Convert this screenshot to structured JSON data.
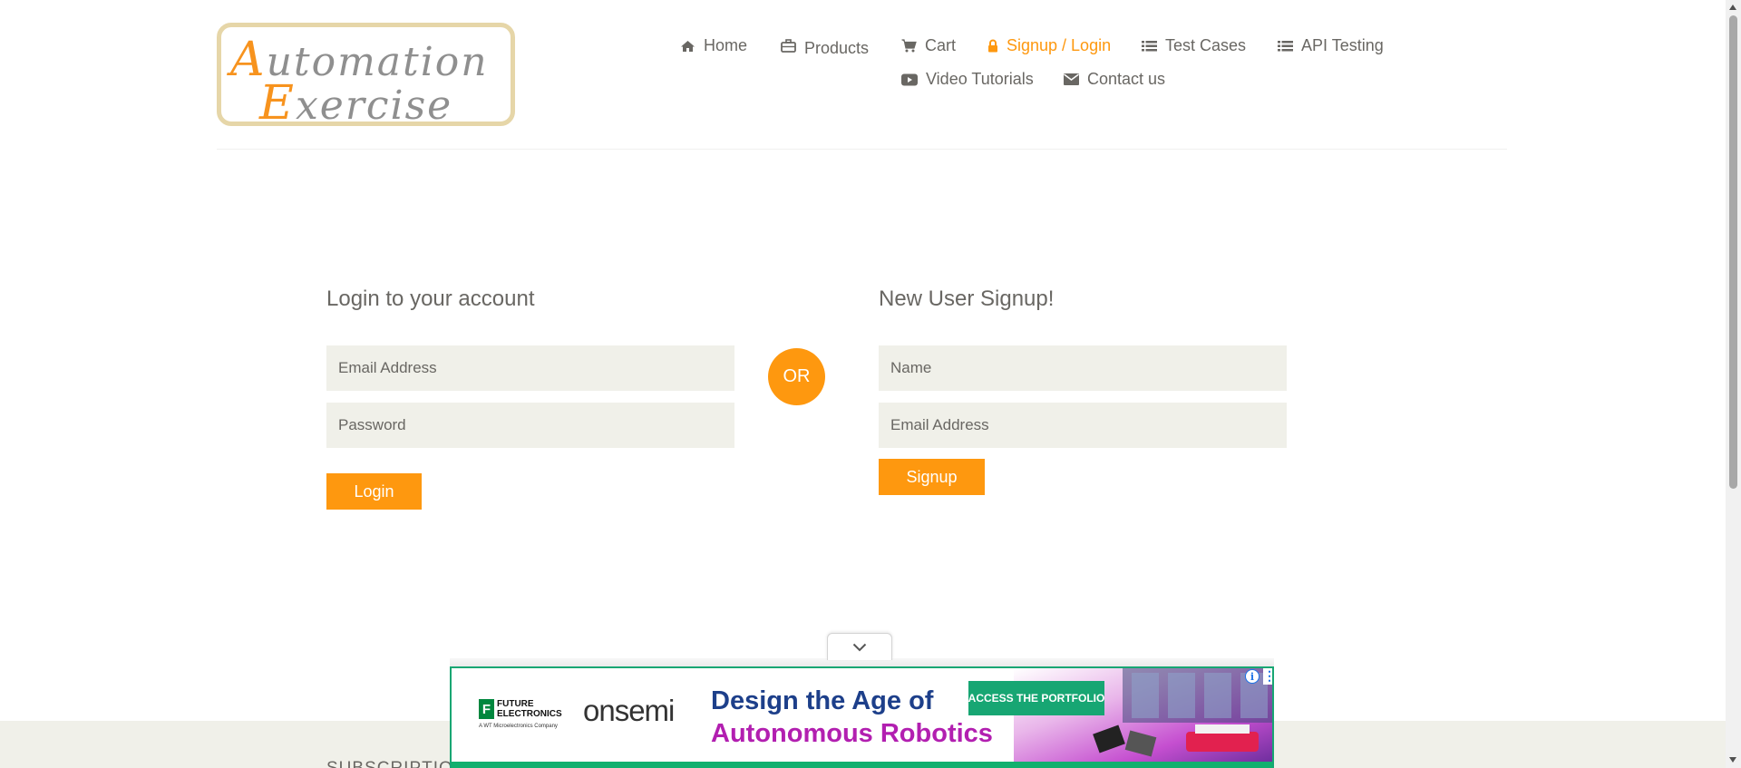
{
  "logo": {
    "line1_first": "A",
    "line1_rest": "utomation",
    "line2_first": "E",
    "line2_rest": "xercise"
  },
  "nav": [
    {
      "label": "Home",
      "icon": "home-icon"
    },
    {
      "label": "Products",
      "icon": "briefcase-icon"
    },
    {
      "label": "Cart",
      "icon": "cart-icon"
    },
    {
      "label": "Signup / Login",
      "icon": "lock-icon",
      "active": true
    },
    {
      "label": "Test Cases",
      "icon": "list-icon"
    },
    {
      "label": "API Testing",
      "icon": "list-icon"
    },
    {
      "label": "Video Tutorials",
      "icon": "youtube-play-icon"
    },
    {
      "label": "Contact us",
      "icon": "envelope-icon"
    }
  ],
  "login": {
    "title": "Login to your account",
    "email_placeholder": "Email Address",
    "password_placeholder": "Password",
    "button": "Login"
  },
  "or_label": "OR",
  "signup": {
    "title": "New User Signup!",
    "name_placeholder": "Name",
    "email_placeholder": "Email Address",
    "button": "Signup"
  },
  "footer": {
    "subscription_title": "SUBSCRIPTION"
  },
  "ad": {
    "brand1_box": "F",
    "brand1_line1": "FUTURE",
    "brand1_line2": "ELECTRONICS",
    "brand1_sub": "A WT Microelectronics Company",
    "brand2": "onsemi",
    "headline1": "Design the Age of",
    "headline2": "Autonomous Robotics",
    "cta": "ACCESS THE PORTFOLIO",
    "info_glyph": "i",
    "menu_glyph": "⋮"
  },
  "colors": {
    "accent": "#fe980f",
    "text": "#696763",
    "field_bg": "#f0f0e9",
    "ad_green": "#17a673"
  }
}
